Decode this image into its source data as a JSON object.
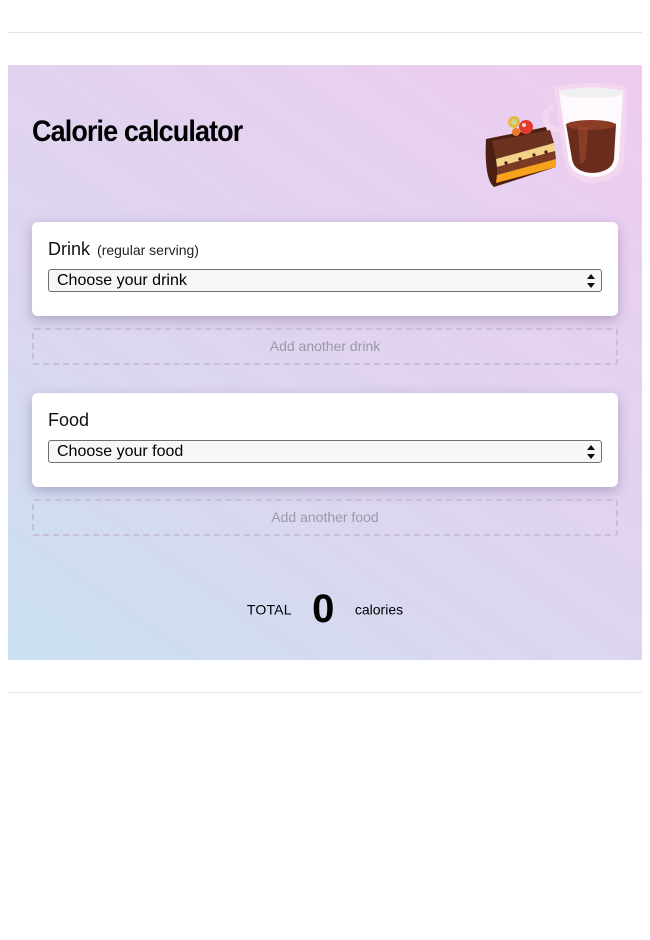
{
  "calculator": {
    "title": "Calorie calculator",
    "illustration_icon": "cake-and-coffee-icon",
    "drink": {
      "label": "Drink",
      "hint": "(regular serving)",
      "select": {
        "selected": "Choose your drink"
      },
      "add_label": "Add another drink"
    },
    "food": {
      "label": "Food",
      "select": {
        "selected": "Choose your food"
      },
      "add_label": "Add another food"
    },
    "total": {
      "label": "TOTAL",
      "value": "0",
      "unit": "calories"
    }
  },
  "colors": {
    "gradient_start": "#c9e0f1",
    "gradient_end": "#efccef",
    "dashed_border": "#c6bfd6"
  }
}
